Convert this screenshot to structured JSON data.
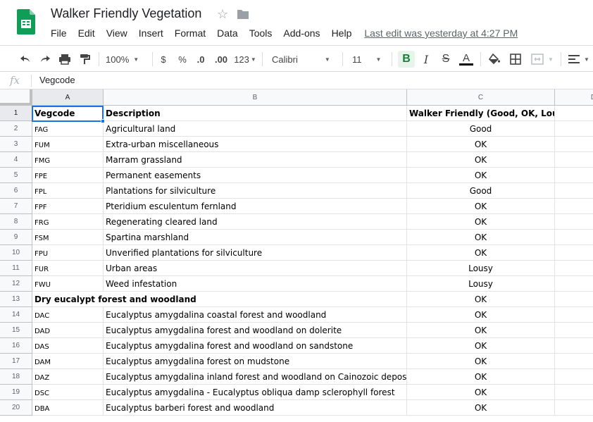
{
  "app": {
    "doc_title": "Walker Friendly Vegetation",
    "last_edit": "Last edit was yesterday at 4:27 PM",
    "menu": [
      "File",
      "Edit",
      "View",
      "Insert",
      "Format",
      "Data",
      "Tools",
      "Add-ons",
      "Help"
    ]
  },
  "toolbar": {
    "zoom": "100%",
    "currency": "$",
    "percent": "%",
    "decrease_decimal": ".0",
    "increase_decimal": ".00",
    "more_formats": "123",
    "font": "Calibri",
    "font_size": "11",
    "bold": "B",
    "italic": "I",
    "strikethrough": "S",
    "text_color": "A"
  },
  "formula_bar": {
    "fx": "fx",
    "content": "Vegcode"
  },
  "sheet": {
    "columns": [
      "A",
      "B",
      "C",
      "D"
    ],
    "rows": [
      {
        "n": "1",
        "a": "Vegcode",
        "b": "Description",
        "c": "Walker Friendly (Good, OK, Lousy)"
      },
      {
        "n": "2",
        "a": "FAG",
        "b": "Agricultural land",
        "c": "Good"
      },
      {
        "n": "3",
        "a": "FUM",
        "b": "Extra-urban miscellaneous",
        "c": "OK"
      },
      {
        "n": "4",
        "a": "FMG",
        "b": "Marram grassland",
        "c": "OK"
      },
      {
        "n": "5",
        "a": "FPE",
        "b": "Permanent easements",
        "c": "OK"
      },
      {
        "n": "6",
        "a": "FPL",
        "b": "Plantations for silviculture",
        "c": "Good"
      },
      {
        "n": "7",
        "a": "FPF",
        "b": "Pteridium esculentum fernland",
        "c": "OK"
      },
      {
        "n": "8",
        "a": "FRG",
        "b": "Regenerating cleared land",
        "c": "OK"
      },
      {
        "n": "9",
        "a": "FSM",
        "b": "Spartina marshland",
        "c": "OK"
      },
      {
        "n": "10",
        "a": "FPU",
        "b": "Unverified plantations for silviculture",
        "c": "OK"
      },
      {
        "n": "11",
        "a": "FUR",
        "b": "Urban areas",
        "c": "Lousy"
      },
      {
        "n": "12",
        "a": "FWU",
        "b": "Weed infestation",
        "c": "Lousy"
      },
      {
        "n": "13",
        "a": "Dry eucalypt forest and woodland",
        "b": "",
        "c": "OK"
      },
      {
        "n": "14",
        "a": "DAC",
        "b": "Eucalyptus amygdalina coastal forest and woodland",
        "c": "OK"
      },
      {
        "n": "15",
        "a": "DAD",
        "b": "Eucalyptus amygdalina forest and woodland on dolerite",
        "c": "OK"
      },
      {
        "n": "16",
        "a": "DAS",
        "b": "Eucalyptus amygdalina forest and woodland on sandstone",
        "c": "OK"
      },
      {
        "n": "17",
        "a": "DAM",
        "b": "Eucalyptus amygdalina forest on mudstone",
        "c": "OK"
      },
      {
        "n": "18",
        "a": "DAZ",
        "b": "Eucalyptus amygdalina inland forest and woodland on Cainozoic deposits",
        "c": "OK"
      },
      {
        "n": "19",
        "a": "DSC",
        "b": "Eucalyptus amygdalina - Eucalyptus obliqua damp sclerophyll forest",
        "c": "OK"
      },
      {
        "n": "20",
        "a": "DBA",
        "b": "Eucalyptus barberi forest and woodland",
        "c": "OK"
      }
    ]
  }
}
